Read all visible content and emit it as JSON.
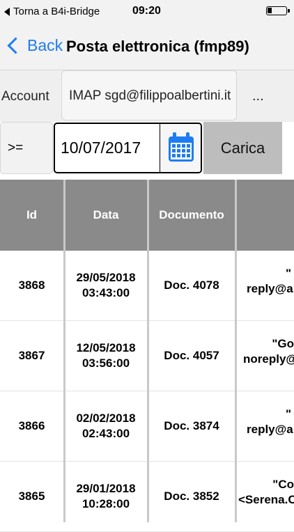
{
  "status_bar": {
    "back_app_label": "Torna a B4i-Bridge",
    "time": "09:20",
    "battery_level": 0.25
  },
  "nav": {
    "back_label": "Back",
    "title": "Posta elettronica (fmp89)"
  },
  "account": {
    "label": "Account",
    "value": "IMAP sgd@filippoalbertini.it",
    "more_label": "..."
  },
  "filter": {
    "operator": ">=",
    "date_value": "10/07/2017",
    "calendar_icon": "calendar-icon",
    "load_label": "Carica"
  },
  "table": {
    "headers": [
      "Id",
      "Data",
      "Documento",
      ""
    ],
    "rows": [
      {
        "id": "3868",
        "date": "29/05/2018",
        "time": "03:43:00",
        "doc": "Doc. 4078",
        "sender_line1": "\"",
        "sender_line2": "reply@a"
      },
      {
        "id": "3867",
        "date": "12/05/2018",
        "time": "03:56:00",
        "doc": "Doc. 4057",
        "sender_line1": "\"Go",
        "sender_line2": "noreply@"
      },
      {
        "id": "3866",
        "date": "02/02/2018",
        "time": "02:43:00",
        "doc": "Doc. 3874",
        "sender_line1": "\"",
        "sender_line2": "reply@a"
      },
      {
        "id": "3865",
        "date": "29/01/2018",
        "time": "10:28:00",
        "doc": "Doc. 3852",
        "sender_line1": "\"Co",
        "sender_line2": "<Serena.C"
      }
    ]
  },
  "colors": {
    "accent": "#1e7cf2",
    "header_bg": "#8a8a8a",
    "load_button_bg": "#bdbdbd"
  }
}
